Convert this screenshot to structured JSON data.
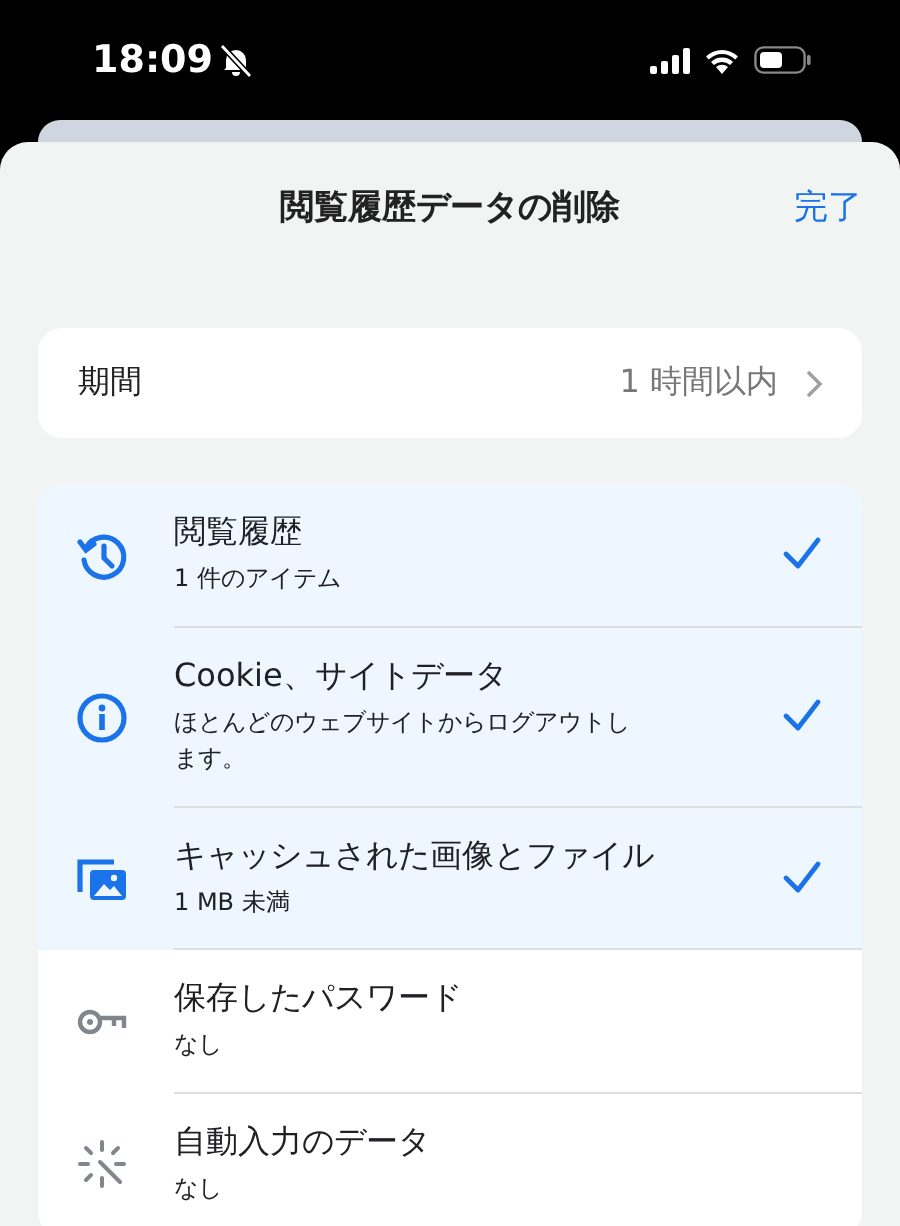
{
  "status_bar": {
    "time": "18:09",
    "silent": true
  },
  "sheet": {
    "title": "閲覧履歴データの削除",
    "done": "完了"
  },
  "period": {
    "label": "期間",
    "value": "1 時間以内"
  },
  "items": [
    {
      "kind": "history",
      "title": "閲覧履歴",
      "subtitle": "1 件のアイテム",
      "selected": true
    },
    {
      "kind": "info",
      "title": "Cookie、サイトデータ",
      "subtitle": "ほとんどのウェブサイトからログアウトします。",
      "selected": true
    },
    {
      "kind": "images",
      "title": "キャッシュされた画像とファイル",
      "subtitle": "1 MB 未満",
      "selected": true
    },
    {
      "kind": "key",
      "title": "保存したパスワード",
      "subtitle": "なし",
      "selected": false
    },
    {
      "kind": "autofill",
      "title": "自動入力のデータ",
      "subtitle": "なし",
      "selected": false
    }
  ]
}
